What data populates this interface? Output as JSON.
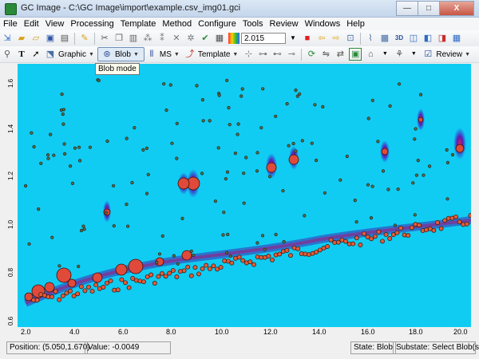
{
  "window": {
    "title": "GC Image - C:\\GC Image\\import\\example.csv_img01.gci",
    "minimize_label": "—",
    "maximize_label": "□",
    "close_label": "X"
  },
  "menu": [
    "File",
    "Edit",
    "View",
    "Processing",
    "Template",
    "Method",
    "Configure",
    "Tools",
    "Review",
    "Windows",
    "Help"
  ],
  "toolbar": {
    "zoom_value": "2.015",
    "graphic_label": "Graphic",
    "blob_label": "Blob",
    "ms_label": "MS",
    "template_label": "Template",
    "review_label": "Review",
    "tooltip": "Blob mode"
  },
  "colors": {
    "background": "#11ccf2",
    "peak_core": "#e04a3a",
    "peak_halo": "#3a2aa8"
  },
  "plot": {
    "y_ticks": [
      "1.6",
      "1.4",
      "1.2",
      "1.0",
      "0.8",
      "0.6"
    ],
    "x_ticks": [
      "2.0",
      "4.0",
      "6.0",
      "8.0",
      "10.0",
      "12.0",
      "14.0",
      "16.0",
      "18.0",
      "20.0"
    ]
  },
  "status": {
    "position": "Position: (5.050,1.670)",
    "value": "Value: -0.0049",
    "state": "State: Blob",
    "substate": "Substate: Select Blob(s)"
  }
}
